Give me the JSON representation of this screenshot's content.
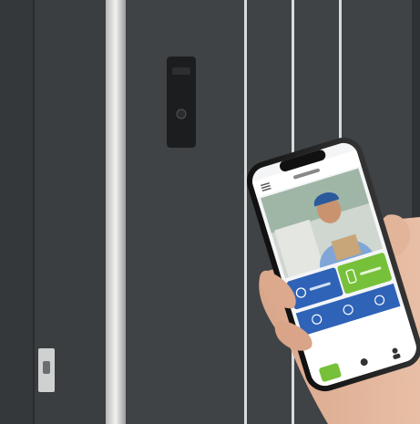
{
  "scene": {
    "description_visible_text": [],
    "door_color": "#3e4245",
    "frame_color": "#2f3336",
    "accent_light": "#e8e8e6",
    "app": {
      "brand": "",
      "accent_green": "#77c13a",
      "accent_blue": "#2f63b8",
      "icons": [
        "menu-icon",
        "video-feed",
        "unlock-icon",
        "intercom-icon",
        "mute-icon",
        "camera-icon",
        "settings-icon",
        "home-tab-icon",
        "bell-tab-icon",
        "user-tab-icon"
      ]
    }
  }
}
